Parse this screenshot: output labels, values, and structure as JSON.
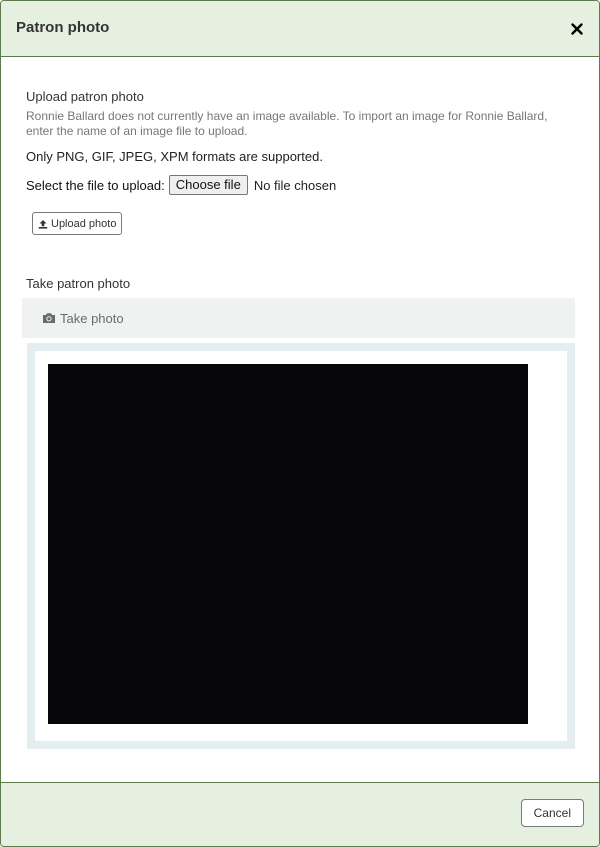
{
  "header": {
    "title": "Patron photo",
    "close_label": "×"
  },
  "upload_section": {
    "heading": "Upload patron photo",
    "hint": "Ronnie Ballard does not currently have an image available. To import an image for Ronnie Ballard, enter the name of an image file to upload.",
    "formats_note": "Only PNG, GIF, JPEG, XPM formats are supported.",
    "file_label": "Select the file to upload:",
    "file_button": "Choose file",
    "file_status": "No file chosen",
    "upload_button": "Upload photo",
    "upload_icon": "upload-icon"
  },
  "camera_section": {
    "heading": "Take patron photo",
    "take_button": "Take photo",
    "take_icon": "camera-icon"
  },
  "footer": {
    "cancel_button": "Cancel"
  },
  "colors": {
    "header_bg": "#e6f0e1",
    "border": "#5c7a4a",
    "video_bg": "#05050a"
  }
}
